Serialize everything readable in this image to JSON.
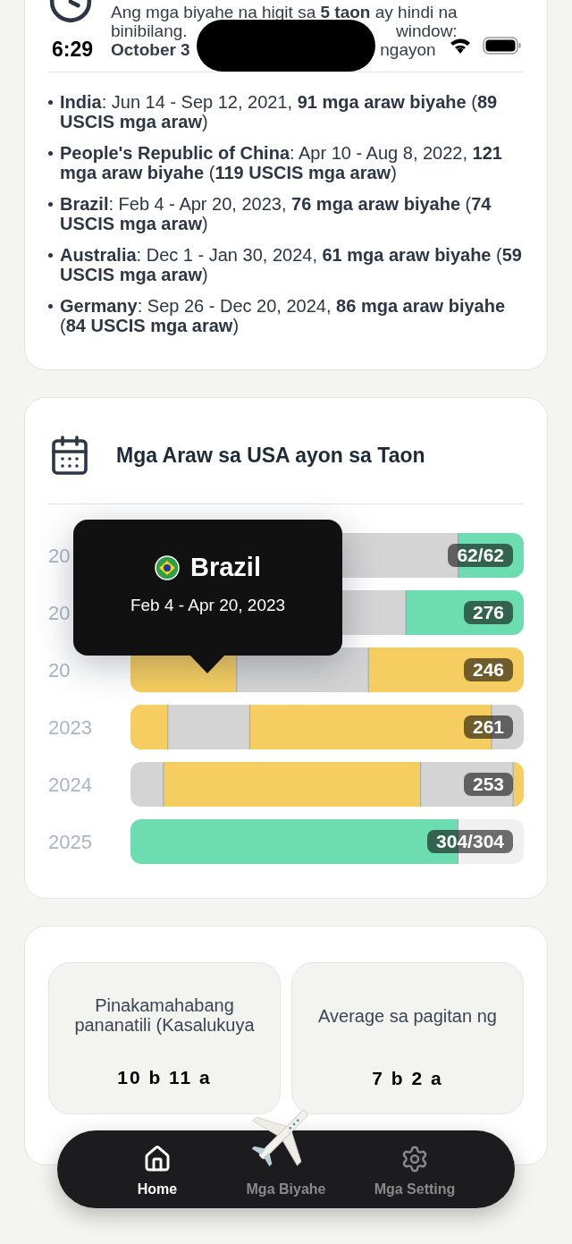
{
  "status_bar": {
    "time": "6:29"
  },
  "notice": {
    "lines": [
      "Ang mga biyahe na higit sa **5 taon** ay hindi na",
      "binibilang."
    ],
    "window_label": "window:",
    "start": "October 3",
    "end": "ngayon"
  },
  "trips": [
    {
      "text": "**India**: Jun 14 - Sep 12, 2021, **91 mga araw biyahe** (**89 USCIS mga araw**)"
    },
    {
      "text": "**People's Republic of China**: Apr 10 - Aug 8, 2022, **121 mga araw biyahe** (**119 USCIS mga araw**)"
    },
    {
      "text": "**Brazil**: Feb 4 - Apr 20, 2023, **76 mga araw biyahe** (**74 USCIS mga araw**)"
    },
    {
      "text": "**Australia**: Dec 1 - Jan 30, 2024, **61 mga araw biyahe** (**59 USCIS mga araw**)"
    },
    {
      "text": "**Germany**: Sep 26 - Dec 20, 2024, **86 mga araw biyahe** (**84 USCIS mga araw**)"
    }
  ],
  "year_chart": {
    "title": "Mga Araw sa USA ayon sa Taon",
    "rows": [
      {
        "year": "20",
        "total": "62/62"
      },
      {
        "year": "20",
        "total": "276"
      },
      {
        "year": "20",
        "total": "246"
      },
      {
        "year": "2023",
        "total": "261"
      },
      {
        "year": "2024",
        "total": "253"
      },
      {
        "year": "2025",
        "total": "304/304"
      }
    ],
    "tooltip": {
      "country": "Brazil",
      "dates": "Feb 4 - Apr 20, 2023"
    }
  },
  "stats": [
    {
      "label": "Pinakamahabang pananatili (Kasalukuya",
      "value": "10 b 11 a"
    },
    {
      "label": "Average sa pagitan ng",
      "value": "7 b 2 a"
    }
  ],
  "nav": [
    {
      "label": "Home",
      "selected": true
    },
    {
      "label": "Mga Biyahe",
      "selected": false
    },
    {
      "label": "Mga Setting",
      "selected": false
    }
  ]
}
